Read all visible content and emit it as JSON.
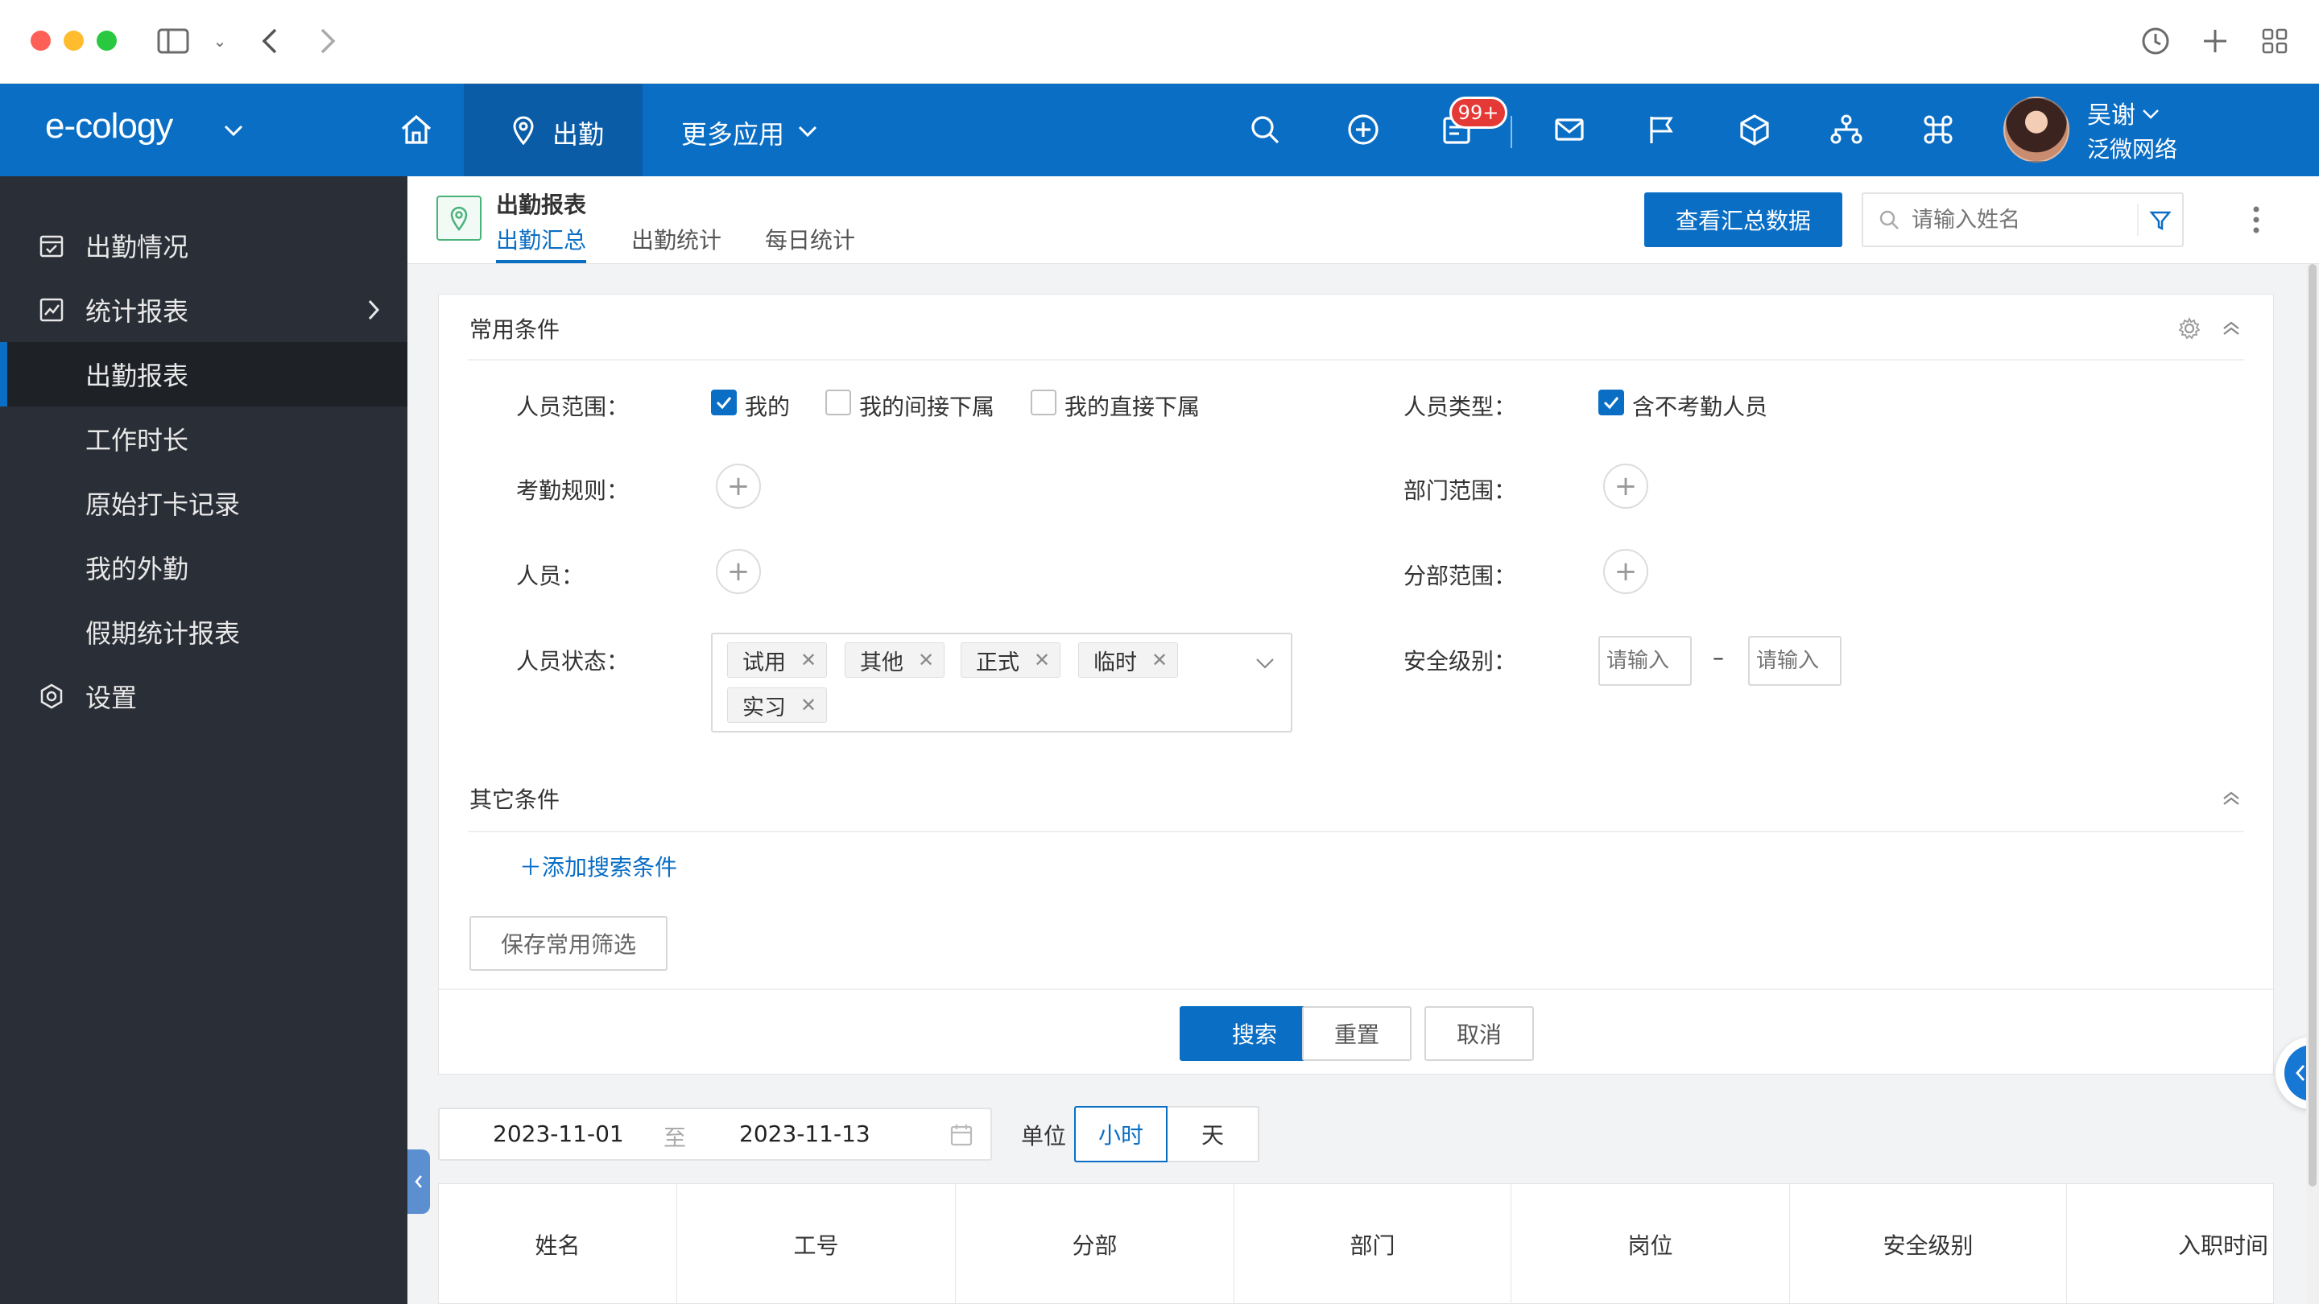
{
  "app": {
    "brand": "e-cology",
    "nav_active": "出勤",
    "nav_more": "更多应用",
    "badge": "99+",
    "user_name": "吴谢",
    "user_org": "泛微网络"
  },
  "sidebar": {
    "items": [
      {
        "label": "出勤情况"
      },
      {
        "label": "统计报表"
      },
      {
        "label": "出勤报表"
      },
      {
        "label": "工作时长"
      },
      {
        "label": "原始打卡记录"
      },
      {
        "label": "我的外勤"
      },
      {
        "label": "假期统计报表"
      },
      {
        "label": "设置"
      }
    ]
  },
  "subheader": {
    "title": "出勤报表",
    "tabs": [
      "出勤汇总",
      "出勤统计",
      "每日统计"
    ],
    "summary_button": "查看汇总数据",
    "search_placeholder": "请输入姓名"
  },
  "filters": {
    "common_title": "常用条件",
    "scope_label": "人员范围：",
    "scope_options": [
      "我的",
      "我的间接下属",
      "我的直接下属"
    ],
    "type_label": "人员类型：",
    "type_option": "含不考勤人员",
    "rule_label": "考勤规则：",
    "dept_label": "部门范围：",
    "person_label": "人员：",
    "branch_label": "分部范围：",
    "status_label": "人员状态：",
    "status_tags": [
      "试用",
      "其他",
      "正式",
      "临时",
      "实习"
    ],
    "security_label": "安全级别：",
    "security_from_placeholder": "请输入",
    "security_to_placeholder": "请输入",
    "security_sep": "–",
    "other_title": "其它条件",
    "add_condition": "添加搜索条件",
    "save_filter": "保存常用筛选",
    "search_btn": "搜索",
    "reset_btn": "重置",
    "cancel_btn": "取消"
  },
  "range": {
    "start": "2023-11-01",
    "to": "至",
    "end": "2023-11-13",
    "unit_label": "单位",
    "unit_options": [
      "小时",
      "天"
    ]
  },
  "table": {
    "columns": [
      "姓名",
      "工号",
      "分部",
      "部门",
      "岗位",
      "安全级别",
      "入职时间"
    ]
  },
  "colors": {
    "primary": "#0a6ec5",
    "sidebar": "#2a2e36",
    "badge": "#e53935"
  }
}
